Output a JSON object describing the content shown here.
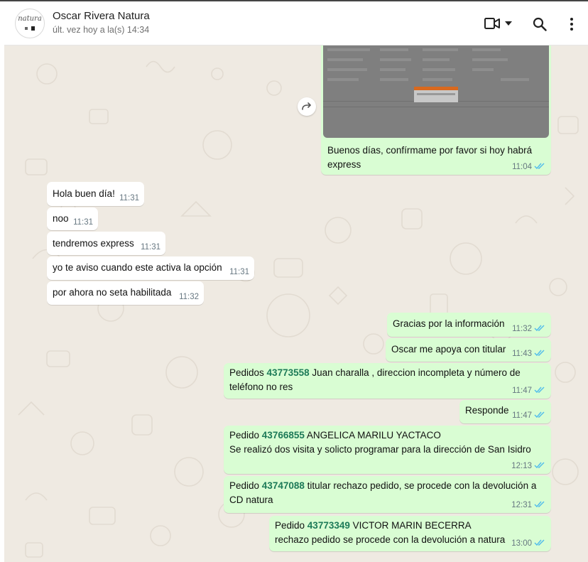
{
  "header": {
    "contact_name": "Oscar Rivera Natura",
    "last_seen": "últ. vez hoy a la(s) 14:34",
    "avatar_brand": "natura"
  },
  "icons": {
    "video_call": "video-camera-icon",
    "dropdown": "chevron-down-icon",
    "search": "search-icon",
    "menu": "more-vertical-icon",
    "forward": "forward-icon",
    "read": "double-check-icon"
  },
  "colors": {
    "outgoing_bubble": "#d9fdd3",
    "incoming_bubble": "#ffffff",
    "chat_background": "#efeae2",
    "order_number": "#1d7a58",
    "read_ticks": "#53bdeb"
  },
  "messages": {
    "image_caption": {
      "text": "Buenos días, confírmame por favor si hoy habrá express",
      "time": "11:04"
    },
    "m1": {
      "text": "Hola buen día!",
      "time": "11:31"
    },
    "m2": {
      "text": "noo",
      "time": "11:31"
    },
    "m3": {
      "text": "tendremos express",
      "time": "11:31"
    },
    "m4": {
      "text": "yo te aviso cuando este activa la opción",
      "time": "11:31"
    },
    "m5": {
      "text": "por ahora no seta habilitada",
      "time": "11:32"
    },
    "m6": {
      "text": "Gracias por la información",
      "time": "11:32"
    },
    "m7": {
      "text": "Oscar me apoya con titular",
      "time": "11:43"
    },
    "m8": {
      "prefix": "Pedidos ",
      "order": "43773558",
      "rest": " Juan charalla , direccion incompleta  y número de",
      "line2": "teléfono no res",
      "time": "11:47"
    },
    "m9": {
      "text": "Responde",
      "time": "11:47"
    },
    "m10": {
      "prefix": "Pedido ",
      "order": "43766855",
      "rest": " ANGELICA MARILU YACTACO",
      "line2": "Se realizó dos visita y solicto programar para la dirección de San Isidro",
      "time": "12:13"
    },
    "m11": {
      "prefix": "Pedido ",
      "order": "43747088",
      "rest": " titular rechazo pedido, se procede con la devolución a",
      "line2": "CD natura",
      "time": "12:31"
    },
    "m12": {
      "prefix": "Pedido ",
      "order": "43773349",
      "rest": "  VICTOR MARIN BECERRA",
      "line2": "rechazo pedido se procede con la devolución a natura",
      "time": "13:00"
    }
  }
}
